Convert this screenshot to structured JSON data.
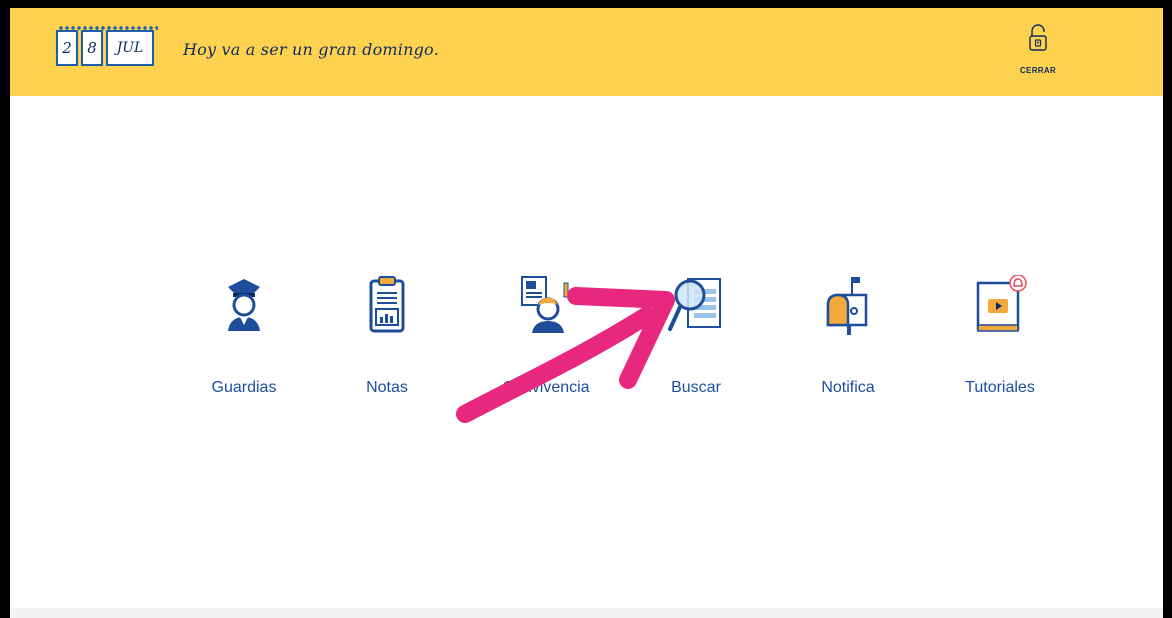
{
  "header": {
    "date": {
      "day1": "2",
      "day2": "8",
      "month": "JUL"
    },
    "greeting": "Hoy va a ser un gran domingo.",
    "logout_label": "CERRAR"
  },
  "menu": [
    {
      "id": "guardias",
      "label": "Guardias",
      "icon": "guard-icon"
    },
    {
      "id": "notas",
      "label": "Notas",
      "icon": "clipboard-chart-icon"
    },
    {
      "id": "convivencia",
      "label": "Convivencia",
      "icon": "student-document-icon"
    },
    {
      "id": "buscar",
      "label": "Buscar",
      "icon": "magnifier-document-icon"
    },
    {
      "id": "notifica",
      "label": "Notifica",
      "icon": "mailbox-icon"
    },
    {
      "id": "tutoriales",
      "label": "Tutoriales",
      "icon": "video-book-icon"
    }
  ],
  "colors": {
    "header_bg": "#fed24f",
    "primary_blue": "#1d4e9a",
    "annotation_pink": "#e8277e",
    "accent_orange": "#f4a93c"
  }
}
